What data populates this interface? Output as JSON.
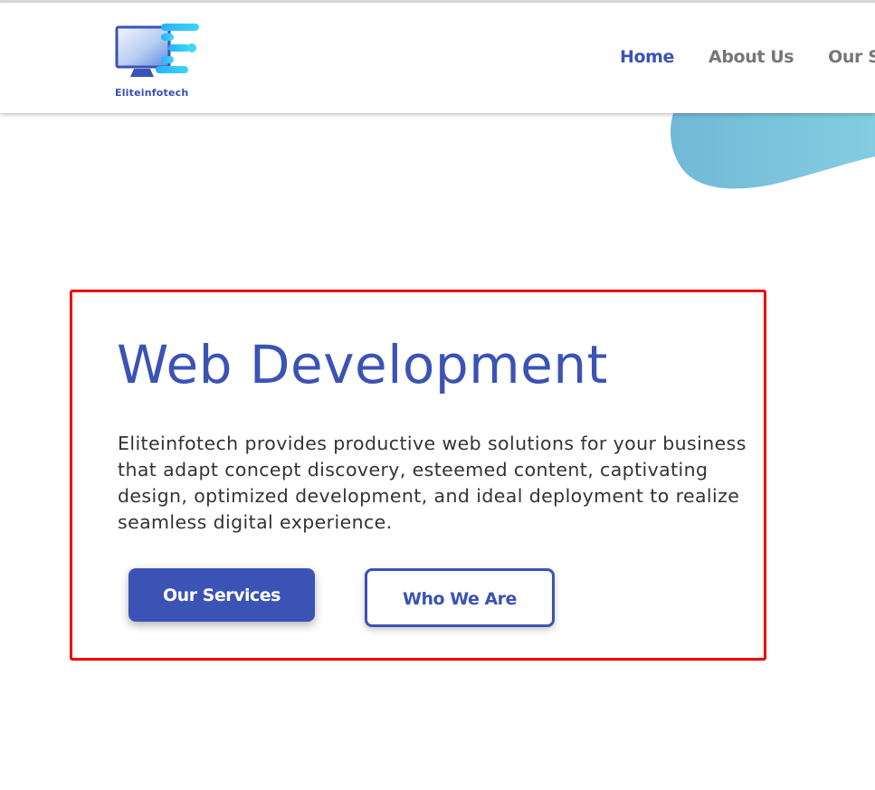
{
  "colors": {
    "brand": "#3b53b5",
    "nav_inactive": "#777777",
    "text": "#333333",
    "highlight_border": "#ee0000",
    "blob": "#7cc4dd"
  },
  "header": {
    "logo": {
      "icon": "monitor-e-logo-icon",
      "text": "Eliteinfotech"
    },
    "nav": [
      {
        "label": "Home",
        "active": true
      },
      {
        "label": "About Us",
        "active": false
      },
      {
        "label": "Our Ser",
        "active": false
      }
    ]
  },
  "hero": {
    "title": "Web Development",
    "description": "Eliteinfotech provides productive web solutions for your business that adapt concept discovery, esteemed content, captivating design, optimized development, and ideal deployment to realize seamless digital experience.",
    "primary_button": "Our Services",
    "secondary_button": "Who We Are"
  }
}
